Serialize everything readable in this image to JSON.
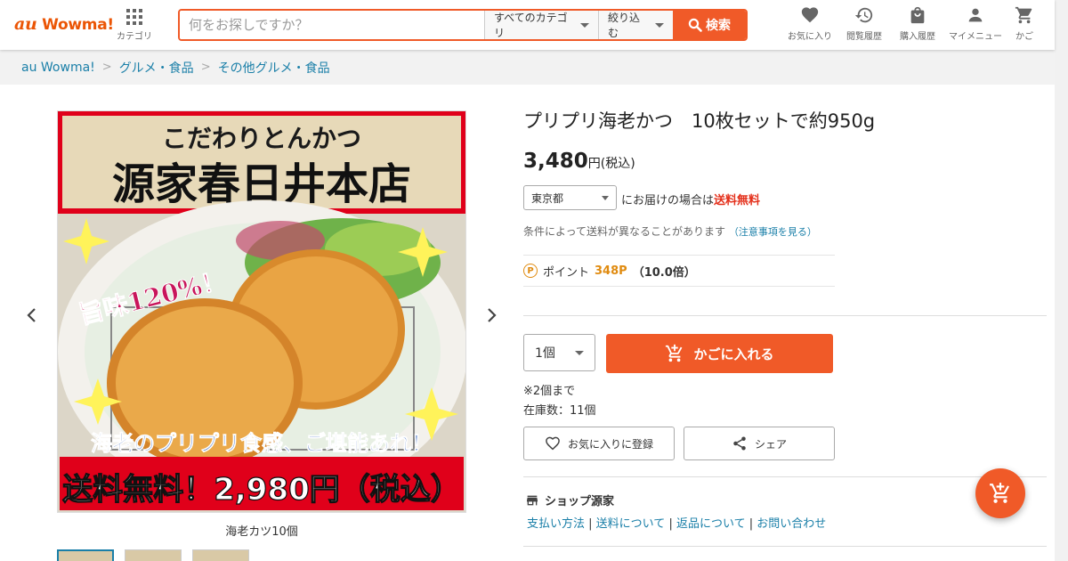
{
  "header": {
    "logo_au": "au",
    "logo_brand": "Wowma!",
    "category_label": "カテゴリ",
    "search_placeholder": "何をお探しですか？",
    "category_select": "すべてのカテゴリ",
    "filter_select": "絞り込む",
    "search_button": "検索",
    "nav": [
      {
        "label": "お気に入り",
        "icon": "heart-icon"
      },
      {
        "label": "閲覧履歴",
        "icon": "history-icon"
      },
      {
        "label": "購入履歴",
        "icon": "bag-icon"
      },
      {
        "label": "マイメニュー",
        "icon": "person-icon"
      },
      {
        "label": "かご",
        "icon": "cart-icon"
      }
    ],
    "accent_color": "#f05a28"
  },
  "breadcrumb": [
    "au Wowma!",
    "グルメ・食品",
    "その他グルメ・食品"
  ],
  "gallery": {
    "image_text_top_small": "こだわりとんかつ",
    "image_text_top_large": "源家春日井本店",
    "image_text_badge": "旨味120%！",
    "image_text_blue": "海老のプリプリ食感、ご堪能あれ！",
    "image_text_banner": "送料無料！2,980円（税込）",
    "caption": "海老カツ10個"
  },
  "product": {
    "title": "プリプリ海老かつ　10枚セットで約950g",
    "price": "3,480",
    "price_unit": "円(税込)",
    "prefecture": "東京都",
    "shipping_prefix": "にお届けの場合は",
    "shipping_free": "送料無料",
    "shipping_note": "条件によって送料が異なることがあります",
    "shipping_note_link": "（注意事項を見る）",
    "points_label": "ポイント",
    "points_value": "348P",
    "points_multiplier": "（10.0倍）",
    "quantity": "1個",
    "cart_button": "かごに入れる",
    "limit": "※2個まで",
    "stock": "在庫数：11個",
    "favorite_button": "お気に入りに登録",
    "share_button": "シェア"
  },
  "shop": {
    "name": "ショップ源家",
    "links": [
      "支払い方法",
      "送料について",
      "返品について",
      "お問い合わせ"
    ]
  }
}
